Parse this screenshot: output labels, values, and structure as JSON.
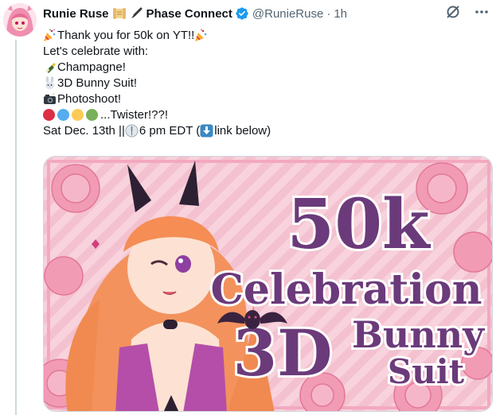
{
  "post": {
    "author_name": "Runie Ruse",
    "affiliation": "Phase Connect",
    "handle": "@RunieRuse",
    "separator": "·",
    "time": "1h",
    "lines": {
      "l1": "Thank you for 50k on YT!!",
      "l2": "Let's celebrate with:",
      "l3": "Champagne!",
      "l4": "3D Bunny Suit!",
      "l5": "Photoshoot!",
      "l6": "...Twister!??!",
      "l7a": "Sat Dec. 13th ||",
      "l7b": " 6 pm EDT (",
      "l7c": "link below)"
    },
    "icons": {
      "header": [
        "scroll-icon",
        "brush-icon",
        "verified-badge-icon"
      ],
      "actions": [
        "grok-icon",
        "more-icon"
      ],
      "emoji": [
        "party-popper-icon",
        "champagne-icon",
        "rabbit-icon",
        "camera-flash-icon",
        "clock-icon",
        "down-arrow-icon"
      ]
    },
    "twister_colors": [
      "#dd2e44",
      "#55acee",
      "#fdcb58",
      "#78b159"
    ]
  },
  "media": {
    "line1": "50k",
    "line2": "Celebration",
    "line3": "3D",
    "line4": "Bunny",
    "line5": "Suit"
  },
  "colors": {
    "accent": "#1d9bf0",
    "muted": "#536471",
    "banner_purple": "#6b3a7a",
    "banner_pink": "#f6c6d4"
  }
}
